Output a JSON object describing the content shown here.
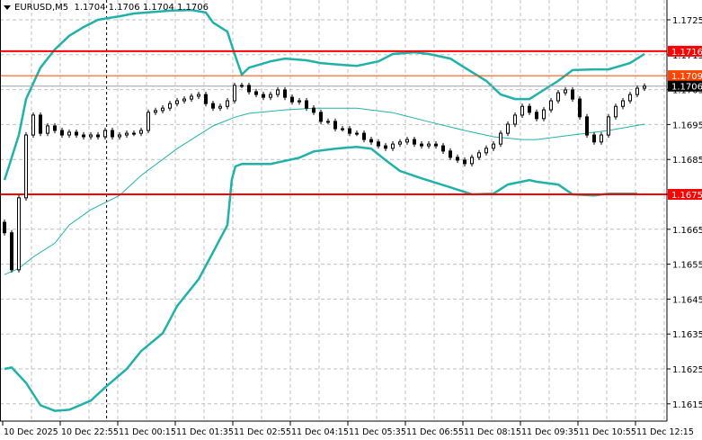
{
  "header": {
    "symbol": "EURUSD,M5",
    "ohlc": "1.1704 1.1706 1.1704 1.1706",
    "menu_icon": "triangle-down-icon"
  },
  "colors": {
    "candle_up": "#ffffff",
    "candle_down": "#000000",
    "band": "#20b2aa",
    "level_line": "#ff0000",
    "ask_line": "#ff4500",
    "bid_line": "#a0a0a0",
    "grid": "#c0c0c0"
  },
  "chart_data": {
    "type": "candlestick",
    "title": "EURUSD,M5",
    "ylim": [
      1.16115,
      1.17305
    ],
    "yticks": [
      "1.1725",
      "1.1715",
      "1.1705",
      "1.1695",
      "1.1685",
      "1.1675",
      "1.1665",
      "1.1655",
      "1.1645",
      "1.1635",
      "1.1625",
      "1.1615"
    ],
    "xtick_labels": [
      "10 Dec 2025",
      "10 Dec 22:55",
      "11 Dec 00:15",
      "11 Dec 01:35",
      "11 Dec 02:55",
      "11 Dec 04:15",
      "11 Dec 05:35",
      "11 Dec 06:55",
      "11 Dec 08:15",
      "11 Dec 09:35",
      "11 Dec 10:55",
      "11 Dec 12:15"
    ],
    "grid": true,
    "closes": [
      1.1664,
      1.16534,
      1.1674,
      1.1692,
      1.16977,
      1.16925,
      1.16946,
      1.16933,
      1.1692,
      1.16928,
      1.1692,
      1.16915,
      1.1692,
      1.16915,
      1.16933,
      1.16915,
      1.1692,
      1.16925,
      1.16925,
      1.16933,
      1.16985,
      1.1699,
      1.16997,
      1.1701,
      1.17018,
      1.17023,
      1.17031,
      1.17036,
      1.1701,
      1.16997,
      1.17002,
      1.17018,
      1.17062,
      1.17062,
      1.17044,
      1.17036,
      1.17028,
      1.17036,
      1.17049,
      1.17028,
      1.17015,
      1.17018,
      1.16997,
      1.16985,
      1.16959,
      1.16959,
      1.16938,
      1.16938,
      1.16925,
      1.16925,
      1.16907,
      1.169,
      1.16889,
      1.16882,
      1.16894,
      1.169,
      1.16907,
      1.16894,
      1.16889,
      1.16894,
      1.16889,
      1.16874,
      1.16856,
      1.16848,
      1.16838,
      1.16856,
      1.16869,
      1.16882,
      1.16894,
      1.16925,
      1.16951,
      1.16977,
      1.17002,
      1.16985,
      1.16967,
      1.16992,
      1.17018,
      1.17041,
      1.17049,
      1.17023,
      1.16972,
      1.1692,
      1.169,
      1.1692,
      1.16972,
      1.17002,
      1.17018,
      1.17036,
      1.17054,
      1.1706
    ],
    "bollinger": {
      "upper": [
        [
          0,
          1.16791
        ],
        [
          1,
          1.16855
        ],
        [
          2,
          1.1692
        ],
        [
          3,
          1.17023
        ],
        [
          5,
          1.17113
        ],
        [
          7,
          1.17165
        ],
        [
          9,
          1.17204
        ],
        [
          11,
          1.17229
        ],
        [
          13,
          1.1725
        ],
        [
          16,
          1.1726
        ],
        [
          18,
          1.17268
        ],
        [
          21,
          1.17273
        ],
        [
          23,
          1.17276
        ],
        [
          26,
          1.17278
        ],
        [
          28,
          1.17271
        ],
        [
          29,
          1.17242
        ],
        [
          31,
          1.17216
        ],
        [
          32,
          1.17152
        ],
        [
          33,
          1.17093
        ],
        [
          34,
          1.17113
        ],
        [
          37,
          1.17131
        ],
        [
          39,
          1.17139
        ],
        [
          42,
          1.17134
        ],
        [
          44,
          1.17126
        ],
        [
          47,
          1.17121
        ],
        [
          49,
          1.17118
        ],
        [
          52,
          1.17131
        ],
        [
          54,
          1.17152
        ],
        [
          57,
          1.17157
        ],
        [
          59,
          1.17152
        ],
        [
          62,
          1.17139
        ],
        [
          64,
          1.17113
        ],
        [
          67,
          1.17075
        ],
        [
          69,
          1.17036
        ],
        [
          71,
          1.17023
        ],
        [
          73,
          1.17023
        ],
        [
          75,
          1.17049
        ],
        [
          77,
          1.17075
        ],
        [
          79,
          1.17106
        ],
        [
          82,
          1.17108
        ],
        [
          84,
          1.17108
        ],
        [
          87,
          1.17126
        ],
        [
          89,
          1.17152
        ]
      ],
      "middle": [
        [
          0,
          1.1652
        ],
        [
          2,
          1.16538
        ],
        [
          4,
          1.16571
        ],
        [
          7,
          1.1661
        ],
        [
          9,
          1.16662
        ],
        [
          12,
          1.16706
        ],
        [
          16,
          1.16747
        ],
        [
          19,
          1.16804
        ],
        [
          24,
          1.16881
        ],
        [
          29,
          1.16946
        ],
        [
          32,
          1.16971
        ],
        [
          34,
          1.16982
        ],
        [
          39,
          1.16992
        ],
        [
          43,
          1.16997
        ],
        [
          49,
          1.16997
        ],
        [
          54,
          1.16984
        ],
        [
          59,
          1.16958
        ],
        [
          64,
          1.16933
        ],
        [
          68,
          1.16915
        ],
        [
          72,
          1.16907
        ],
        [
          74,
          1.16907
        ],
        [
          79,
          1.1692
        ],
        [
          84,
          1.16933
        ],
        [
          89,
          1.16951
        ]
      ],
      "lower": [
        [
          0,
          1.1625
        ],
        [
          1,
          1.16254
        ],
        [
          3,
          1.1621
        ],
        [
          5,
          1.16146
        ],
        [
          7,
          1.1613
        ],
        [
          9,
          1.16133
        ],
        [
          12,
          1.16159
        ],
        [
          14,
          1.16197
        ],
        [
          17,
          1.1625
        ],
        [
          19,
          1.16301
        ],
        [
          22,
          1.16352
        ],
        [
          24,
          1.1643
        ],
        [
          27,
          1.16507
        ],
        [
          29,
          1.16584
        ],
        [
          31,
          1.16662
        ],
        [
          31.6,
          1.16791
        ],
        [
          32.1,
          1.1683
        ],
        [
          33,
          1.16837
        ],
        [
          37,
          1.16837
        ],
        [
          41,
          1.16855
        ],
        [
          43,
          1.16873
        ],
        [
          46,
          1.16881
        ],
        [
          49,
          1.16886
        ],
        [
          51,
          1.16881
        ],
        [
          53,
          1.16848
        ],
        [
          55,
          1.16817
        ],
        [
          58,
          1.16796
        ],
        [
          62,
          1.1677
        ],
        [
          65,
          1.1675
        ],
        [
          68,
          1.16752
        ],
        [
          70,
          1.16778
        ],
        [
          73,
          1.16791
        ],
        [
          74,
          1.16786
        ],
        [
          77,
          1.16778
        ],
        [
          79,
          1.1675
        ],
        [
          82,
          1.16747
        ],
        [
          84,
          1.16752
        ],
        [
          88,
          1.16752
        ]
      ]
    },
    "levels": [
      {
        "price": 1.1716,
        "label": "1.1716",
        "kind": "level"
      },
      {
        "price": 1.1675,
        "label": "1.1675",
        "kind": "level"
      },
      {
        "price": 1.1709,
        "label": "1.1709",
        "kind": "ask"
      },
      {
        "price": 1.1706,
        "label": "1.1706",
        "kind": "bid"
      }
    ],
    "period_separator_bar": 14.2
  }
}
